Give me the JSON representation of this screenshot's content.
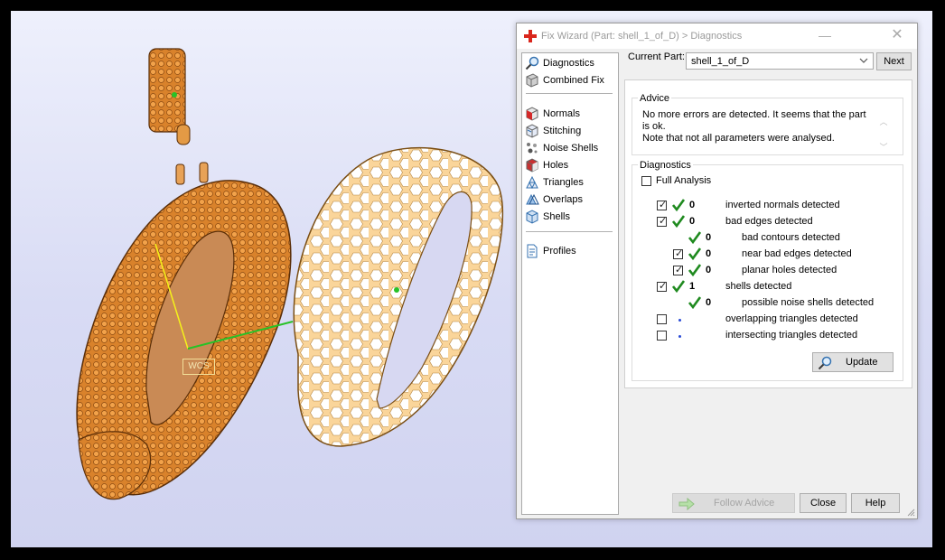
{
  "viewport": {
    "wcs_label": "WCS"
  },
  "dialog": {
    "title": "Fix Wizard (Part: shell_1_of_D) > Diagnostics",
    "nav": {
      "items": [
        {
          "label": "Diagnostics",
          "icon": "magnifier-icon"
        },
        {
          "label": "Combined Fix",
          "icon": "combined-fix-icon"
        },
        {
          "label": "Normals",
          "icon": "normals-cube-icon"
        },
        {
          "label": "Stitching",
          "icon": "stitching-cube-icon"
        },
        {
          "label": "Noise Shells",
          "icon": "noise-shells-icon"
        },
        {
          "label": "Holes",
          "icon": "holes-cube-icon"
        },
        {
          "label": "Triangles",
          "icon": "triangles-icon"
        },
        {
          "label": "Overlaps",
          "icon": "overlaps-icon"
        },
        {
          "label": "Shells",
          "icon": "shells-icon"
        },
        {
          "label": "Profiles",
          "icon": "profiles-doc-icon"
        }
      ]
    },
    "current_part_label": "Current Part:",
    "current_part_value": "shell_1_of_D",
    "next_label": "Next",
    "advice": {
      "title": "Advice",
      "line1": "No more errors are detected. It seems that the part is ok.",
      "line2": "Note that not all parameters were analysed."
    },
    "diagnostics": {
      "title": "Diagnostics",
      "full_analysis_label": "Full Analysis",
      "full_analysis_checked": false,
      "rows": [
        {
          "checkbox": true,
          "checked": true,
          "status": "ok",
          "count": "0",
          "label": "inverted normals detected",
          "indent": 0
        },
        {
          "checkbox": true,
          "checked": true,
          "status": "ok",
          "count": "0",
          "label": "bad edges detected",
          "indent": 0
        },
        {
          "checkbox": false,
          "checked": false,
          "status": "ok",
          "count": "0",
          "label": "bad contours detected",
          "indent": 1
        },
        {
          "checkbox": true,
          "checked": true,
          "status": "ok",
          "count": "0",
          "label": "near bad edges detected",
          "indent": 1
        },
        {
          "checkbox": true,
          "checked": true,
          "status": "ok",
          "count": "0",
          "label": "planar holes detected",
          "indent": 1
        },
        {
          "checkbox": true,
          "checked": true,
          "status": "ok",
          "count": "1",
          "label": "shells detected",
          "indent": 0
        },
        {
          "checkbox": false,
          "checked": false,
          "status": "ok",
          "count": "0",
          "label": "possible noise shells detected",
          "indent": 1
        },
        {
          "checkbox": true,
          "checked": false,
          "status": "pending",
          "count": "",
          "label": "overlapping triangles detected",
          "indent": 0
        },
        {
          "checkbox": true,
          "checked": false,
          "status": "pending",
          "count": "",
          "label": "intersecting triangles detected",
          "indent": 0
        }
      ],
      "update_label": "Update"
    },
    "footer": {
      "follow_advice_label": "Follow Advice",
      "close_label": "Close",
      "help_label": "Help"
    },
    "colors": {
      "ok_check": "#1f8a1f",
      "pending_dot": "#2a4bd6",
      "title_icon": "#d9261c"
    }
  }
}
